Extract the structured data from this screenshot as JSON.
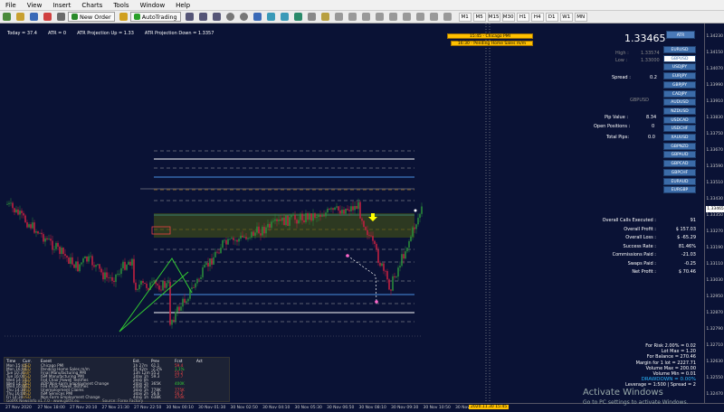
{
  "menu": [
    "File",
    "View",
    "Insert",
    "Charts",
    "Tools",
    "Window",
    "Help"
  ],
  "toolbar": {
    "new_order": "New Order",
    "autotrading": "AutoTrading",
    "timeframes": [
      "M1",
      "M5",
      "M15",
      "M30",
      "H1",
      "H4",
      "D1",
      "W1",
      "MN"
    ]
  },
  "info": {
    "today": "Today = 37.4",
    "atr": "ATR = 0",
    "atr_up": "ATR Projection Up = 1.33",
    "atr_down": "ATR Projection Down = 1.3357"
  },
  "yellow": [
    "15:45 - Chicago PMI",
    "16:30 - Pending Home Sales m/m"
  ],
  "panel": {
    "price": "1.33465",
    "atr_button": "ATR",
    "high_label": "High :",
    "high_value": "1.33574",
    "low_label": "Low :",
    "low_value": "1.33000",
    "spread_label": "Spread :",
    "spread_value": "0.2",
    "symbol_label": "GBPUSD",
    "pip_label": "Pip Value :",
    "pip_value": "8.34",
    "open_label": "Open Positions :",
    "open_value": "0",
    "pips_label": "Total Pips:",
    "pips_value": "0.0",
    "symbols": [
      "EURUSD",
      "GBPUSD",
      "USDJPY",
      "EURJPY",
      "GBPJPY",
      "CADJPY",
      "AUDUSD",
      "NZDUSD",
      "USDCAD",
      "USDCHF",
      "XAUUSD",
      "GBPNZD",
      "GBPAUD",
      "GBPCAD",
      "GBPCHF",
      "EURAUD",
      "EURGBP"
    ],
    "selected": "GBPUSD"
  },
  "stats": [
    [
      "Overall Calls Executed :",
      "91"
    ],
    [
      "Overall Profit :",
      "$ 157.03"
    ],
    [
      "Overall Loss :",
      "$ -65.29"
    ],
    [
      "Success Rate :",
      "81.46%"
    ],
    [
      "Commissions Paid :",
      "-21.03"
    ],
    [
      "Swaps Paid :",
      "-0.25"
    ],
    [
      "Net Profit :",
      "$ 70.46"
    ]
  ],
  "risk": [
    "For Risk 2.00% = 0.02",
    "Lot Max = 1.20",
    "For Balance = 270.46",
    "Margin for 1 lot = 2227.71",
    "Volume Max = 200.00",
    "Volume Min = 0.01",
    "DRAWDOWN = 0.00%",
    "Leverage = 1:500 | Spread = 2"
  ],
  "news": {
    "headers": [
      "Time",
      "Curr.",
      "Event",
      "Est.",
      "Prev",
      "Fcst",
      "Act"
    ],
    "rows": [
      [
        "Mon 15:45",
        "USD",
        "Chicago PMI",
        "1h 27m",
        "61.1",
        "59.4",
        ""
      ],
      [
        "Mon 16:00",
        "USD",
        "Pending Home Sales m/m",
        "1h 42m",
        "-2.2%",
        "1.1%",
        ""
      ],
      [
        "Tue 10:30",
        "GBP",
        "Final Manufacturing PMI",
        "13h 12m",
        "55.2",
        "55.2",
        ""
      ],
      [
        "Tue 16:00",
        "USD",
        "ISM Manufacturing PMI",
        "1day 1h",
        "59.3",
        "57.7",
        ""
      ],
      [
        "Wed 14:15",
        "USD",
        "Fed Chair Powell Testifies",
        "2day 0h",
        "",
        "",
        " "
      ],
      [
        "Wed 14:15",
        "USD",
        "ADP Non-Farm Employment Change",
        "2day 1h",
        "365K",
        "400K",
        ""
      ],
      [
        "Wed 16:00",
        "USD",
        "Fed Chair Powell Testifies",
        "2day 2h",
        "",
        "",
        ""
      ],
      [
        "Thu 14:30",
        "USD",
        "Unemployment Claims",
        "3day 1h",
        "778K",
        "775K",
        ""
      ],
      [
        "Thu 16:00",
        "USD",
        "ISM Services PMI",
        "3day 2h",
        "56.6",
        "56.2",
        ""
      ],
      [
        "Fri 14:30",
        "USD",
        "Non-Farm Employment Change",
        "4day 1h",
        "638K",
        "470K",
        ""
      ]
    ],
    "footer": "GotPX NewsInfo v1.7.0 · www.gotfx.eu",
    "source": "Source: Forex Factory"
  },
  "yaxis": [
    "1.34230",
    "1.34150",
    "1.34070",
    "1.33990",
    "1.33910",
    "1.33830",
    "1.33750",
    "1.33670",
    "1.33590",
    "1.33510",
    "1.33430",
    "1.33350",
    "1.33270",
    "1.33190",
    "1.33110",
    "1.33030",
    "1.32950",
    "1.32870",
    "1.32790",
    "1.32710",
    "1.32630",
    "1.32550",
    "1.32470"
  ],
  "xaxis": [
    "27 Nov 2020",
    "27 Nov 18:00",
    "27 Nov 20:10",
    "27 Nov 21:30",
    "27 Nov 22:50",
    "30 Nov 00:10",
    "30 Nov 01:30",
    "30 Nov 02:50",
    "30 Nov 04:10",
    "30 Nov 05:30",
    "30 Nov 06:50",
    "30 Nov 08:10",
    "30 Nov 09:30",
    "30 Nov 10:50",
    "30 Nov 12:10"
  ],
  "xlabel_current": "2020.11.30 15:45",
  "price_tag": "1.33465",
  "activate": "Activate Windows",
  "activate_sub": "Go to PC settings to activate Windows."
}
